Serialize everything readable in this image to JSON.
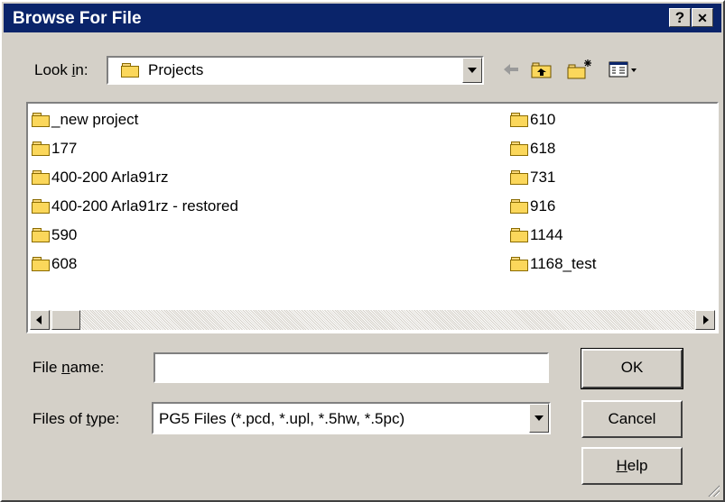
{
  "window": {
    "title": "Browse For File",
    "help_glyph": "?",
    "close_glyph": "✕"
  },
  "look_in": {
    "label_prefix": "Look ",
    "label_underlined": "i",
    "label_suffix": "n:",
    "value": "Projects",
    "icon": "folder-icon"
  },
  "toolbar": {
    "back_icon": "back-arrow-icon",
    "up_icon": "up-one-level-icon",
    "new_folder_icon": "new-folder-icon",
    "view_menu_icon": "view-menu-icon"
  },
  "file_list": {
    "column1": [
      "_new project",
      "177",
      "400-200 Arla91rz",
      "400-200 Arla91rz - restored",
      "590",
      "608"
    ],
    "column2": [
      "610",
      "618",
      "731",
      "916",
      "1144",
      "1168_test"
    ]
  },
  "file_name": {
    "label_prefix": "File ",
    "label_underlined": "n",
    "label_suffix": "ame:",
    "value": ""
  },
  "file_type": {
    "label_prefix": "Files of ",
    "label_underlined": "t",
    "label_suffix": "ype:",
    "value": "PG5 Files (*.pcd, *.upl, *.5hw, *.5pc)"
  },
  "buttons": {
    "ok": "OK",
    "cancel": "Cancel",
    "help_underlined": "H",
    "help_rest": "elp"
  },
  "colors": {
    "titlebar": "#0a246a",
    "face": "#d4d0c8",
    "folder": "#fbd75b"
  }
}
